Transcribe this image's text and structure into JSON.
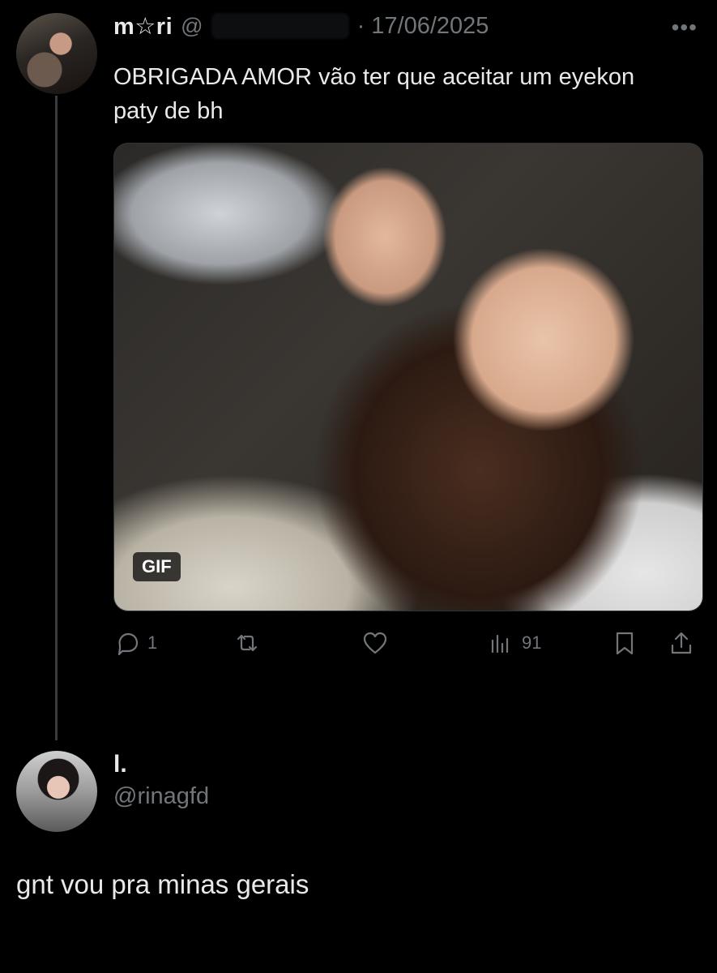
{
  "tweet": {
    "display_name": "m☆ri",
    "handle_prefix": "@",
    "date": "· 17/06/2025",
    "more": "•••",
    "text": "OBRIGADA AMOR vão ter que aceitar um eyekon paty de bh",
    "media_badge": "GIF",
    "replies": "1",
    "retweets": "",
    "likes": "",
    "views": "91"
  },
  "reply": {
    "display_name": "l.",
    "handle": "@rinagfd",
    "text": "gnt vou pra minas gerais"
  }
}
